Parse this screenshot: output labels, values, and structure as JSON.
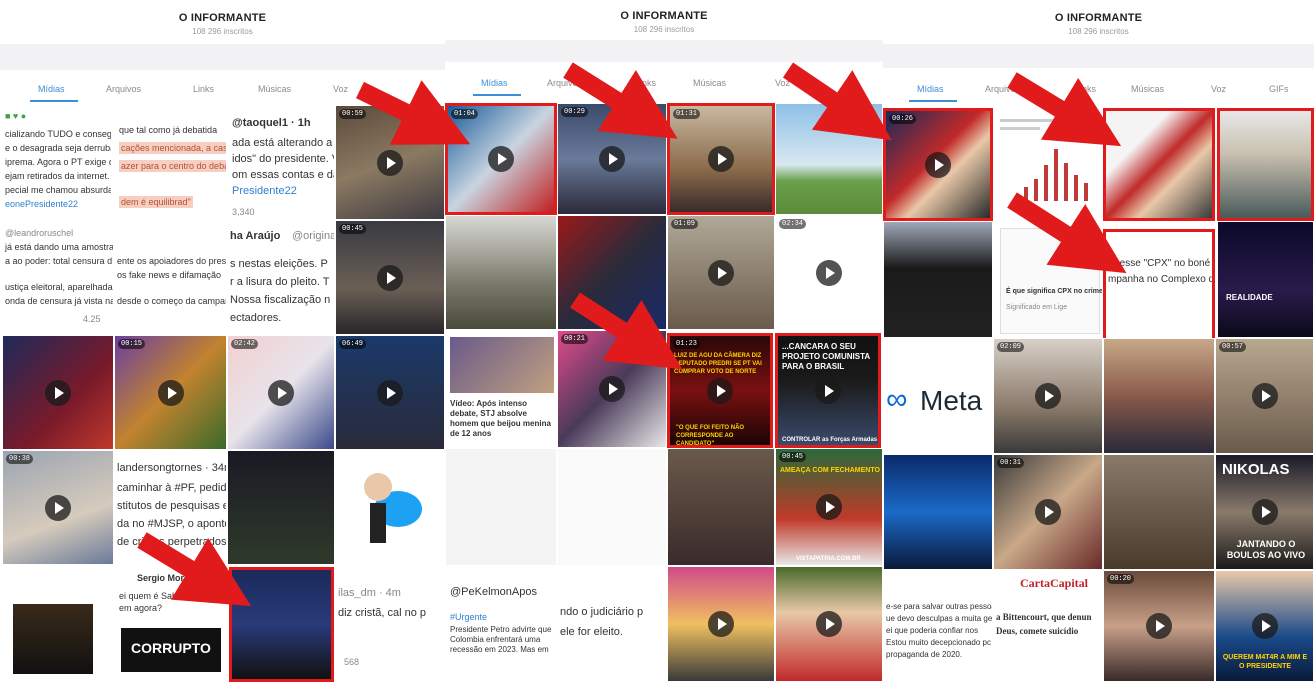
{
  "channel": {
    "title": "O INFORMANTE",
    "subscribers": "108 296 inscritos"
  },
  "tabs": [
    "Mídias",
    "Arquivos",
    "Links",
    "Músicas",
    "Voz",
    "GIFs"
  ],
  "panel1": {
    "tweet1": {
      "line1": "cializando TUDO e conseguir",
      "line2": "e o desagrada seja derrubad",
      "line3": "iprema. Agora o PT exige cu",
      "line4": "ejam retirados da internet. N",
      "line5": "pecial me chamou absurdam",
      "line6": "eonePresidente22",
      "hl1": "que tal como já debatida",
      "hl2": "cações mencionada, a cas",
      "hl3": "azer para o centro do debate",
      "hl4": "dem é equilibrad\""
    },
    "tweet2": {
      "handle": "@taoquel1 · 1h",
      "l1": "ada está alterando a fo",
      "l2": "idos\" do presidente. Ve",
      "l3": "om essas contas e dar",
      "l4": "Presidente22",
      "count": "3,340"
    },
    "tweet3": {
      "handle": "@leandroruschel",
      "l1": "já está dando uma amostra eleitoral para eleger o e",
      "l2": "a ao poder: total censura d",
      "l3": "ustiça eleitoral, aparelhada",
      "l4": "onda de censura já vista na",
      "l5": "os fake news e difamação",
      "l6": "ente os apoiadores do presid",
      "l7": "desde o começo da campanh",
      "stats": "4.25"
    },
    "tweet4": {
      "name": "ha Araújo",
      "handle": "@original",
      "l1": "s nestas eleições. P",
      "l2": "r a lisura do pleito. T",
      "l3": "Nossa fiscalização n",
      "l4": "ectadores."
    },
    "tweet5": {
      "handle": "landersongtornes · 34m",
      "l1": "caminhar à #PF, pedido",
      "l2": "stitutos de pesquisas ele",
      "l3": "da no #MJSP, o aponto",
      "l4": "de crimes perpetrados\""
    },
    "tweet6": {
      "name": "Sergio Moro",
      "l1": "ei quem é Saberia se não",
      "l2": "em agora?"
    },
    "corrupto": "CORRUPTO",
    "tweet7": {
      "handle": "ilas_dm · 4m",
      "l1": "diz cristã, cal no p",
      "count": "568"
    },
    "durations": [
      "00:59",
      "00:45",
      "00:15",
      "02:42",
      "06:49",
      "00:38"
    ]
  },
  "panel2": {
    "durations": [
      "01:04",
      "00:29",
      "01:31",
      "01:09",
      "02:34",
      "00:21",
      "01:23",
      "00:45"
    ],
    "caption1": "Vídeo: Após intenso debate, STJ absolve homem que beijou menina de 12 anos",
    "overlay_red": "LUIZ DE AGU DA CÂMERA DIZ DEPUTADO PREDRI SE PT VAI COMPRAR VOTO DE NORTE",
    "overlay_red2": "\"O QUE FOI FEITO NÃO CORRESPONDE AO CANDIDATO\"",
    "overlay_projeto": "...CANCARA O SEU PROJETO COMUNISTA PARA O BRASIL",
    "controlar": "CONTROLAR as Forças Armadas",
    "ameaca": "AMEAÇA COM FECHAMENTO DE IGREJAS",
    "site": "VISTAPATRIA.COM.BR",
    "tweet_handle": "@PeKelmonApos",
    "tweet_l1": "ndo o judiciário p",
    "tweet_l2": "ele for eleito.",
    "tweet_blue": "#Urgente",
    "tweet_body": "Presidente Petro advirte que Colombia enfrentará uma recessão em 2023. Mas em"
  },
  "panel3": {
    "durations": [
      "00:26",
      "02:09",
      "00:57",
      "00:31",
      "00:20"
    ],
    "card_q": "É que significa CPX no crime?",
    "card_q2": "Significado em Lige",
    "card_cpx": "er esse \"CPX\" no boné qu",
    "card_cpx2": "mpanha no Complexo do Al",
    "meta": "Meta",
    "nikolas": "NIKOLAS",
    "jantando": "JANTANDO O BOULOS AO VIVO",
    "carta": "CartaCapital",
    "carta_l1": "e-se para salvar outras pessoa",
    "carta_l2": "ue devo desculpas a muita gent",
    "carta_l3": "ei que poderia confiar nos",
    "carta_l4": "Estou muito decepcionado pc",
    "carta_l5": "propaganda de 2020.",
    "bittencourt": "a Bittencourt, que denun",
    "bittencourt2": "Deus, comete suicídio",
    "querem": "QUEREM M4T4R A MIM E O PRESIDENTE",
    "realidade": "REALIDADE"
  },
  "colors": {
    "accent": "#3b8fd9",
    "highlight": "#e11b1b",
    "banner": "#f2f2f4"
  }
}
